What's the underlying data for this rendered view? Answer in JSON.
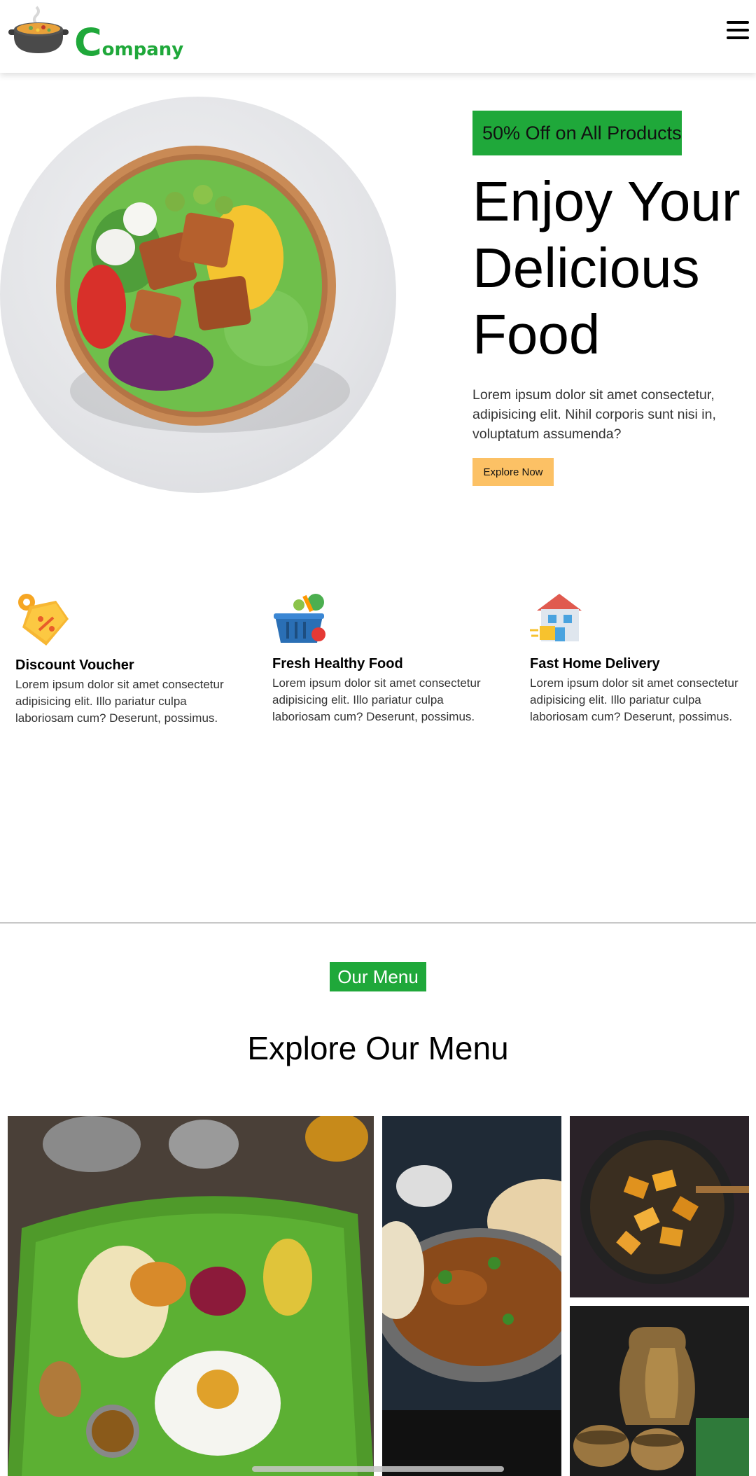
{
  "brand": {
    "logo_letter": "C",
    "logo_rest": "ompany",
    "icon": "cooking-pot-icon",
    "color": "#1fa83a"
  },
  "header": {
    "menu_icon": "hamburger-icon"
  },
  "hero": {
    "promo": "50% Off on All Products",
    "title": "Enjoy Your Delicious Food",
    "description": "Lorem ipsum dolor sit amet consectetur, adipisicing elit. Nihil corporis sunt nisi in, voluptatum assumenda?",
    "cta": "Explore Now",
    "cta_color": "#fcc165",
    "image": "salad-bowl-image"
  },
  "features": [
    {
      "icon": "discount-tag-icon",
      "title": "Discount Voucher",
      "text": "Lorem ipsum dolor sit amet consectetur adipisicing elit. Illo pariatur culpa laboriosam cum? Deserunt, possimus."
    },
    {
      "icon": "grocery-basket-icon",
      "title": "Fresh Healthy Food",
      "text": "Lorem ipsum dolor sit amet consectetur adipisicing elit. Illo pariatur culpa laboriosam cum? Deserunt, possimus."
    },
    {
      "icon": "home-delivery-icon",
      "title": "Fast Home Delivery",
      "text": "Lorem ipsum dolor sit amet consectetur adipisicing elit. Illo pariatur culpa laboriosam cum? Deserunt, possimus."
    }
  ],
  "menu_section": {
    "badge": "Our Menu",
    "heading": "Explore Our Menu",
    "images": [
      "banana-leaf-meal-image",
      "curry-pan-image",
      "fried-potatoes-pan-image",
      "brass-pitcher-image"
    ]
  }
}
